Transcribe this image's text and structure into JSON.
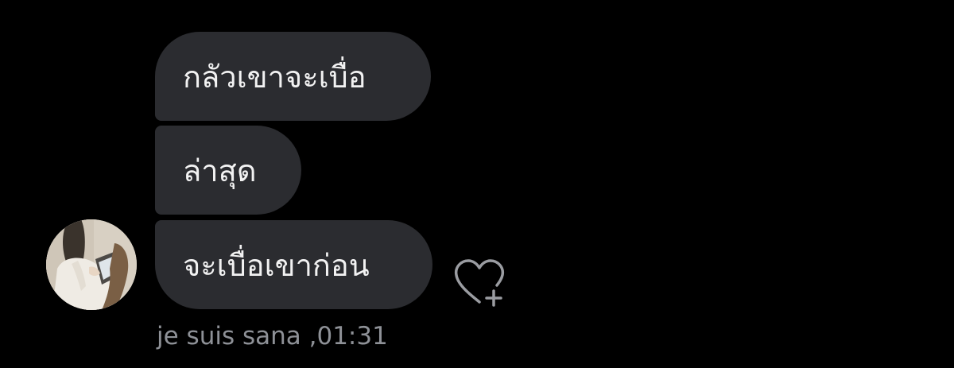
{
  "messages": [
    {
      "text": "กลัวเขาจะเบื่อ"
    },
    {
      "text": "ล่าสุด"
    },
    {
      "text": "จะเบื่อเขาก่อน"
    }
  ],
  "sender": {
    "name": "je suis sana",
    "separator": " ,",
    "time": "01:31"
  },
  "icons": {
    "avatar": "profile-photo",
    "reaction": "heart-plus-icon"
  },
  "colors": {
    "background": "#000000",
    "bubble": "#2b2c30",
    "bubble_text": "#f2f2f2",
    "meta_text": "#8e9197",
    "icon": "#9a9ca1"
  }
}
